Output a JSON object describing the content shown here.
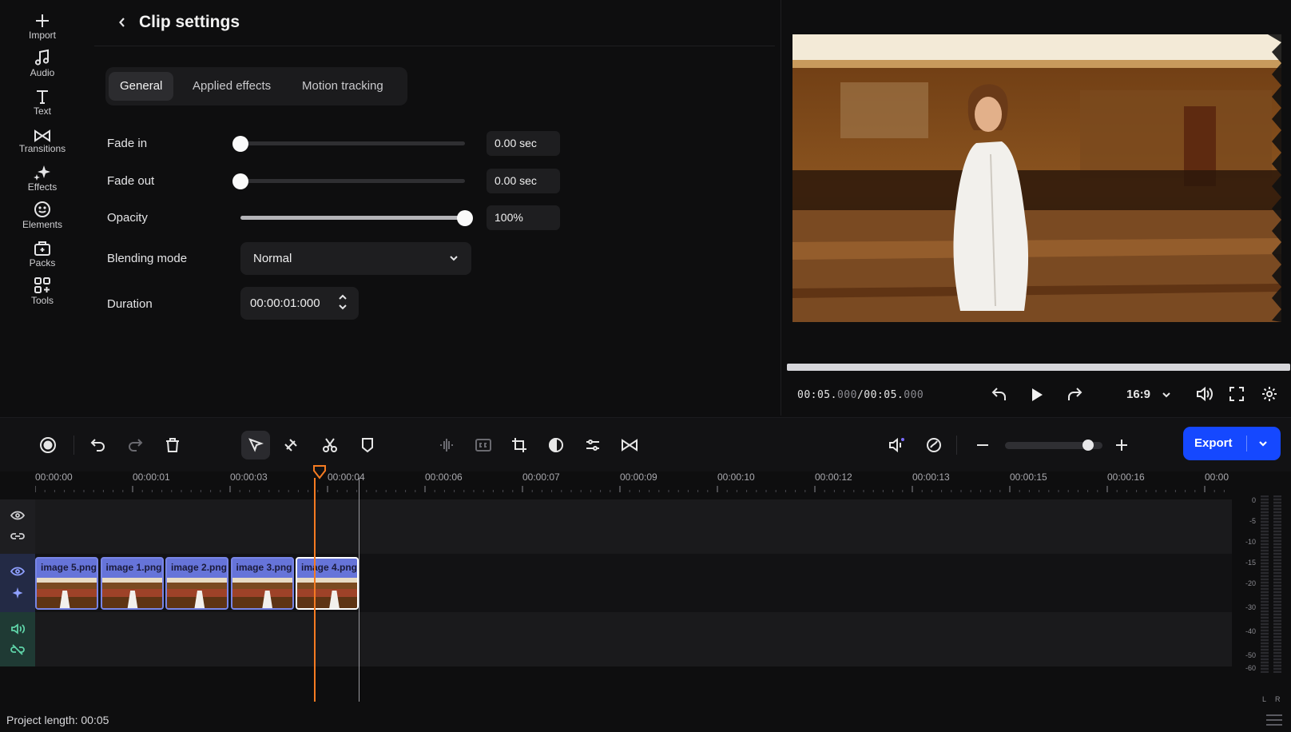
{
  "nav": {
    "items": [
      {
        "label": "Import",
        "icon": "plus-icon"
      },
      {
        "label": "Audio",
        "icon": "music-note-icon"
      },
      {
        "label": "Text",
        "icon": "text-icon"
      },
      {
        "label": "Transitions",
        "icon": "transitions-icon"
      },
      {
        "label": "Effects",
        "icon": "sparkle-icon"
      },
      {
        "label": "Elements",
        "icon": "smiley-icon"
      },
      {
        "label": "Packs",
        "icon": "packs-icon"
      },
      {
        "label": "Tools",
        "icon": "tools-grid-icon"
      }
    ]
  },
  "panel": {
    "title": "Clip settings",
    "tabs": [
      "General",
      "Applied effects",
      "Motion tracking"
    ],
    "active_tab": "General",
    "fade_in": {
      "label": "Fade in",
      "value": "0.00 sec",
      "level": 0
    },
    "fade_out": {
      "label": "Fade out",
      "value": "0.00 sec",
      "level": 0
    },
    "opacity": {
      "label": "Opacity",
      "value": "100%",
      "level": 1.0
    },
    "blending": {
      "label": "Blending mode",
      "value": "Normal"
    },
    "duration": {
      "label": "Duration",
      "value": "00:00:01:000"
    }
  },
  "player": {
    "current_time": "00:05.",
    "current_ms": "000",
    "separator": "/",
    "total_time": "00:05.",
    "total_ms": "000",
    "aspect": "16:9",
    "progress": 1.0
  },
  "toolbar": {
    "export_label": "Export",
    "zoom_level": 0.85
  },
  "timeline": {
    "ticks": [
      "00:00:00",
      "00:00:01",
      "00:00:03",
      "00:00:04",
      "00:00:06",
      "00:00:07",
      "00:00:09",
      "00:00:10",
      "00:00:12",
      "00:00:13",
      "00:00:15",
      "00:00:16",
      "00:00"
    ],
    "clips": [
      {
        "label": "image 5.png"
      },
      {
        "label": "image 1.png"
      },
      {
        "label": "image 2.png"
      },
      {
        "label": "image 3.png"
      },
      {
        "label": "image 4.png",
        "selected": true
      }
    ],
    "meter_scale": [
      "0",
      "-5",
      "-10",
      "-15",
      "-20",
      "-30",
      "-40",
      "-50",
      "-60"
    ],
    "meter_channels": [
      "L",
      "R"
    ]
  },
  "status": {
    "project_length": "Project length: 00:05"
  },
  "colors": {
    "accent": "#1548ff",
    "playhead": "#f57b22",
    "clip": "#6674d9",
    "audio_head": "#1f3a34"
  }
}
